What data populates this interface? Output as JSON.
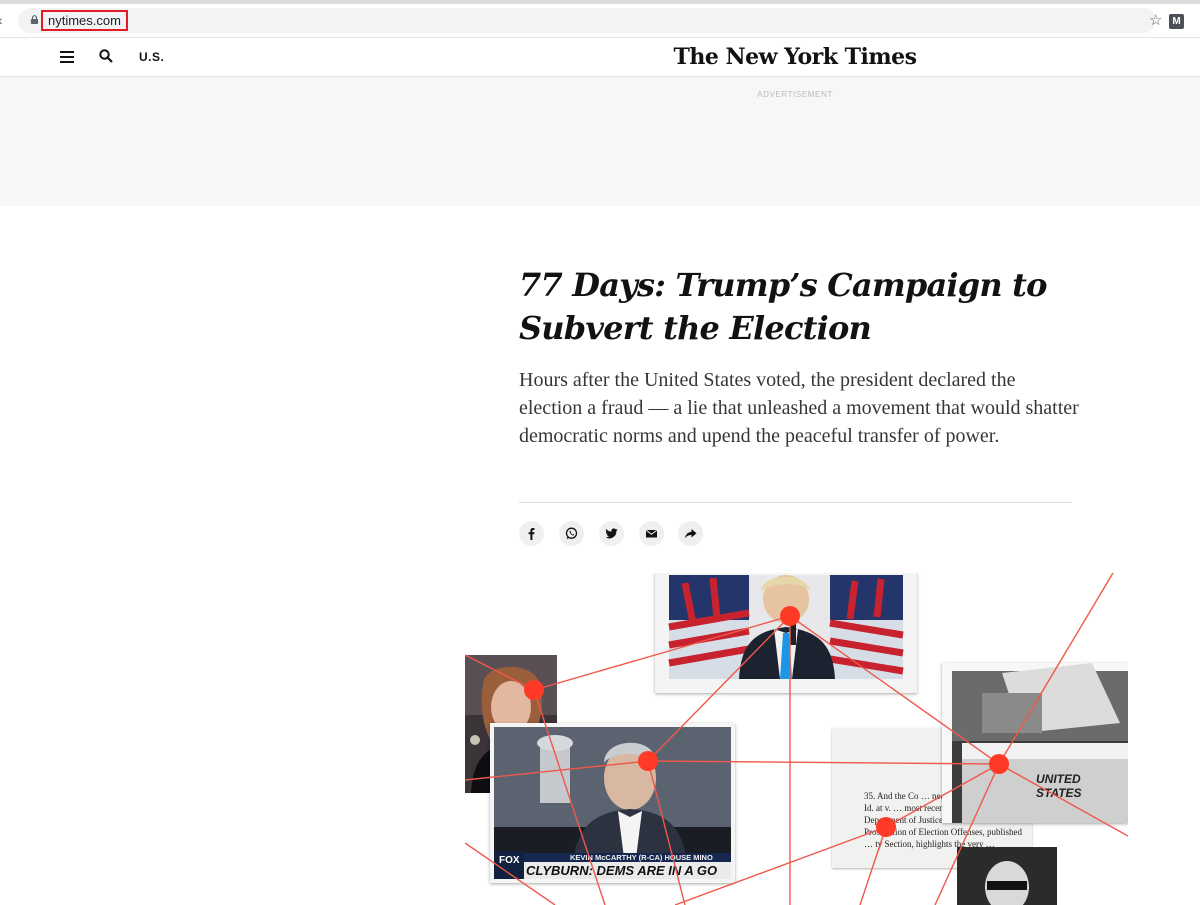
{
  "browser": {
    "url": "nytimes.com",
    "back_icon": "back-arrow-icon",
    "lock_icon": "lock-icon",
    "bookmark_icon": "star-icon",
    "extension_label": "M"
  },
  "nav": {
    "menu_icon": "hamburger-icon",
    "search_icon": "search-icon",
    "section_label": "U.S.",
    "masthead": "The New York Times"
  },
  "ad": {
    "label": "ADVERTISEMENT"
  },
  "article": {
    "headline": "77 Days: Trump’s Campaign to Subvert the Election",
    "summary": "Hours after the United States voted, the president declared the election a fraud — a lie that unleashed a movement that would shatter democratic norms and upend the peaceful transfer of power.",
    "share_icons": [
      "facebook-icon",
      "whatsapp-icon",
      "twitter-icon",
      "email-icon",
      "share-icon"
    ]
  },
  "collage": {
    "caption_lower_third": "KEVIN McCARTHY (R-CA) HOUSE MINO",
    "caption_banner": "CLYBURN: DEMS ARE IN A GO",
    "ballot_box_label": "UNITED STATES",
    "document_text": "35. And the Co … need to do m … fraud. Id. at v. … most recent edition of the U.S. Department of Justice’s Manual on Federal Prosecution of Election Offenses, published … ty Section, highlights the very …",
    "accent_color": "#ff3b28",
    "line_color": "#f0584a"
  },
  "colors": {
    "highlight_box": "#e31b23",
    "text": "#121212"
  }
}
